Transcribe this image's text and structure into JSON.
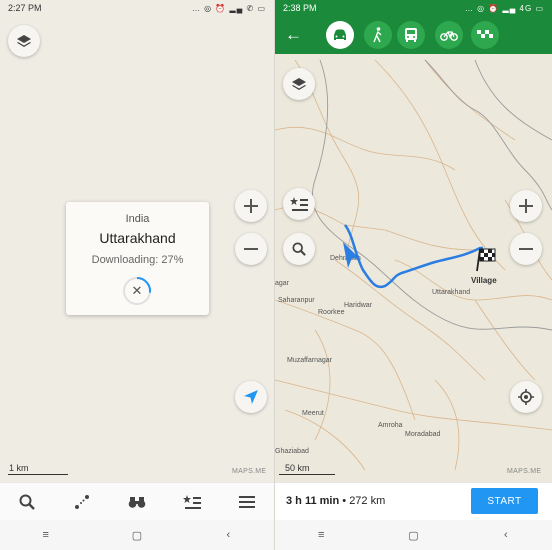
{
  "left": {
    "status": {
      "time": "2:27 PM",
      "icons": "… ◎ ⏰ ▂▄ ✆ ▭"
    },
    "download_card": {
      "country": "India",
      "region": "Uttarakhand",
      "status": "Downloading: 27%",
      "progress": 0.27
    },
    "scale_label": "1 km",
    "attribution": "MAPS.ME",
    "bottom_bar": [
      "search-icon",
      "route-icon",
      "discover-icon",
      "bookmarks-icon",
      "menu-icon"
    ]
  },
  "right": {
    "status": {
      "time": "2:38 PM",
      "icons": "… ◎ ⏰ ▂▄ 4G ▭"
    },
    "transport_modes": [
      "car",
      "pedestrian",
      "transit",
      "bicycle",
      "taxi"
    ],
    "active_mode": "car",
    "map_labels": {
      "dehradun": "Dehradun",
      "saharanpur": "Saharanpur",
      "haridwar": "Haridwar",
      "roorkee": "Roorkee",
      "uttarakhand": "Uttarakhand",
      "village": "Village",
      "muzaffarnagar": "Muzaffarnagar",
      "meerut": "Meerut",
      "amroha": "Amroha",
      "moradabad": "Moradabad",
      "ghaziabad": "Ghaziabad",
      "nagar": "agar"
    },
    "scale_label": "50 km",
    "attribution": "MAPS.ME",
    "route_summary": {
      "duration": "3 h 11 min",
      "separator": "•",
      "distance": "272 km"
    },
    "start_label": "START"
  },
  "android_nav": {
    "recent": "≡",
    "home": "▢",
    "back": "‹"
  },
  "colors": {
    "accent_green": "#1b8a3a",
    "start_blue": "#2196f3",
    "route_blue": "#2b7de1"
  }
}
